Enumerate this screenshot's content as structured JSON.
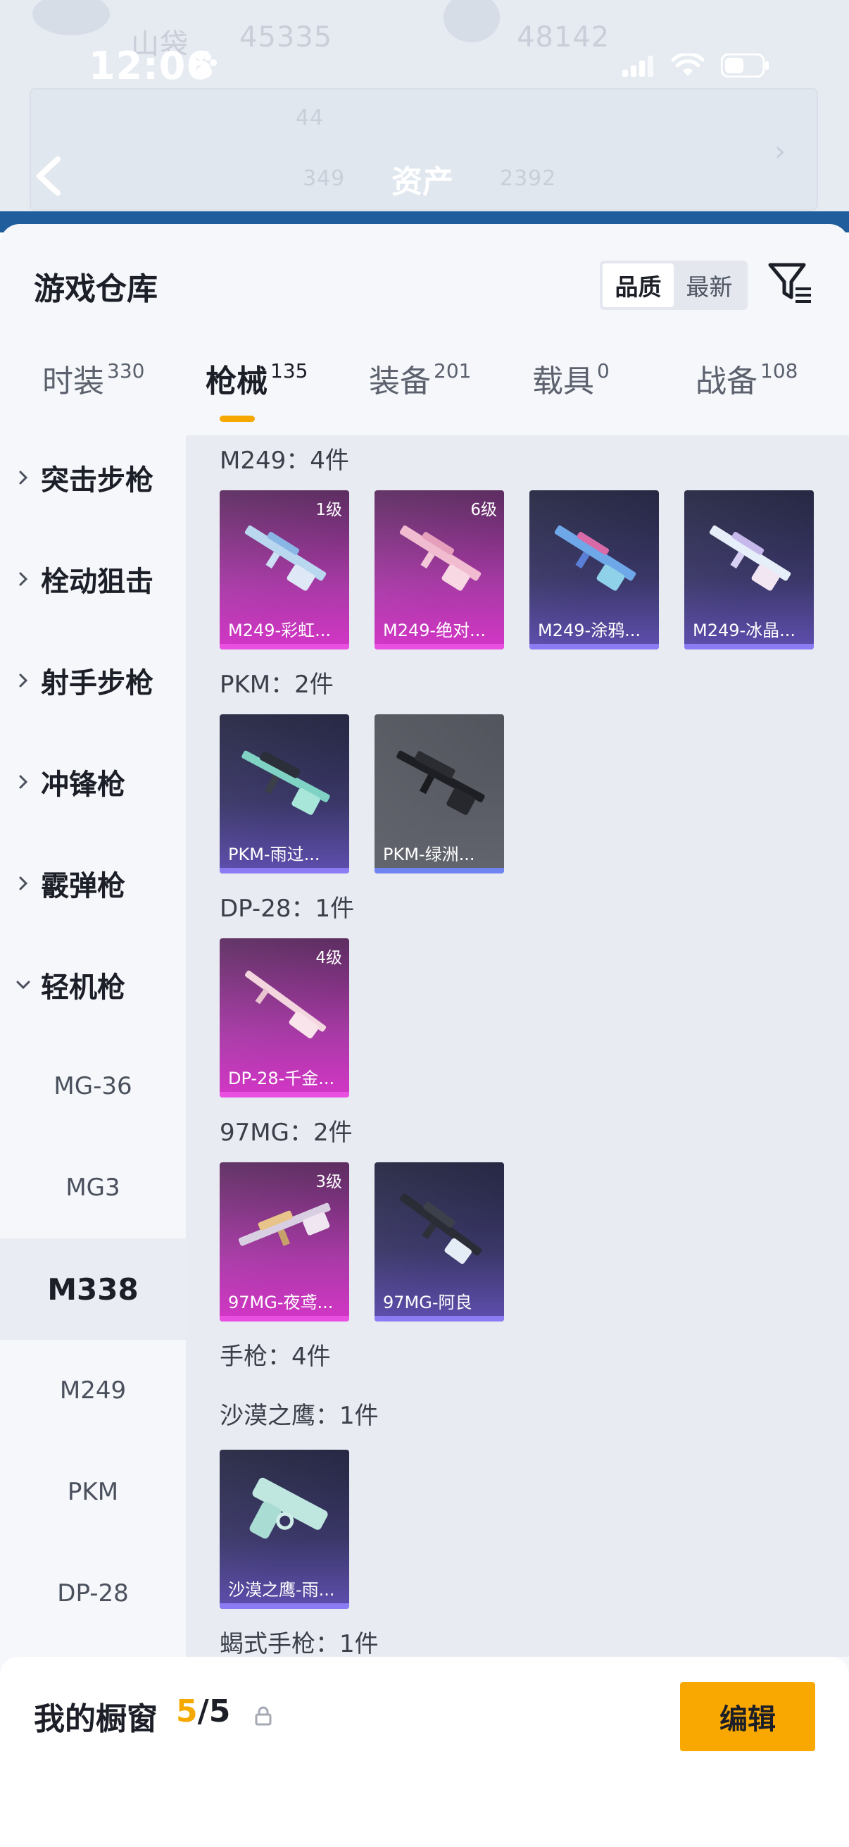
{
  "status": {
    "time": "12:06"
  },
  "background": {
    "title": "资产",
    "faint_texts": [
      "山袋",
      "45335",
      "48142",
      "44",
      "349",
      "2392"
    ]
  },
  "sheet": {
    "title": "游戏仓库",
    "sort": {
      "options": [
        "品质",
        "最新"
      ],
      "active": "品质"
    }
  },
  "tabs": [
    {
      "label": "时装",
      "count": "330"
    },
    {
      "label": "枪械",
      "count": "135"
    },
    {
      "label": "装备",
      "count": "201"
    },
    {
      "label": "载具",
      "count": "0"
    },
    {
      "label": "战备",
      "count": "108"
    }
  ],
  "active_tab": "枪械",
  "sidebar": {
    "categories": [
      {
        "label": "突击步枪",
        "expanded": false
      },
      {
        "label": "栓动狙击",
        "expanded": false
      },
      {
        "label": "射手步枪",
        "expanded": false
      },
      {
        "label": "冲锋枪",
        "expanded": false
      },
      {
        "label": "霰弹枪",
        "expanded": false
      },
      {
        "label": "轻机枪",
        "expanded": true
      }
    ],
    "subitems": [
      "MG-36",
      "MG3",
      "M338",
      "M249",
      "PKM",
      "DP-28"
    ],
    "active_subitem": "M338"
  },
  "groups": [
    {
      "heading": "M249：4件",
      "items": [
        {
          "name": "M249-彩虹...",
          "level": "1级",
          "rarity": "pink"
        },
        {
          "name": "M249-绝对...",
          "level": "6级",
          "rarity": "pink"
        },
        {
          "name": "M249-涂鸦...",
          "level": "",
          "rarity": "purple"
        },
        {
          "name": "M249-冰晶...",
          "level": "",
          "rarity": "purple"
        }
      ]
    },
    {
      "heading": "PKM：2件",
      "items": [
        {
          "name": "PKM-雨过...",
          "level": "",
          "rarity": "purple"
        },
        {
          "name": "PKM-绿洲...",
          "level": "",
          "rarity": "gray"
        }
      ]
    },
    {
      "heading": "DP-28：1件",
      "items": [
        {
          "name": "DP-28-千金...",
          "level": "4级",
          "rarity": "pink"
        }
      ]
    },
    {
      "heading": "97MG：2件",
      "items": [
        {
          "name": "97MG-夜鸢...",
          "level": "3级",
          "rarity": "pink"
        },
        {
          "name": "97MG-阿良",
          "level": "",
          "rarity": "purple"
        }
      ]
    },
    {
      "heading": "手枪：4件",
      "items": []
    },
    {
      "heading": "沙漠之鹰：1件",
      "items": [
        {
          "name": "沙漠之鹰-雨...",
          "level": "",
          "rarity": "purple"
        }
      ]
    },
    {
      "heading": "蝎式手枪：1件",
      "items": []
    }
  ],
  "bottom": {
    "title": "我的橱窗",
    "current": "5",
    "total": "/5",
    "edit_label": "编辑"
  },
  "colors": {
    "accent": "#f5a900",
    "pink_rarity": "#e94fe0",
    "purple_rarity": "#8b7cf4"
  }
}
